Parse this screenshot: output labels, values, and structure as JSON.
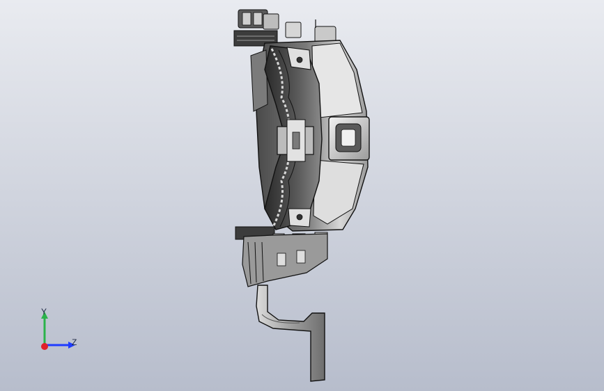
{
  "viewport": {
    "background_top": "#e9ebf0",
    "background_bottom": "#b7bdcc"
  },
  "triad": {
    "y_label": "Y",
    "z_label": "Z",
    "y_color": "#2bb34a",
    "z_color": "#1f3cff",
    "x_color": "#e0202a"
  }
}
